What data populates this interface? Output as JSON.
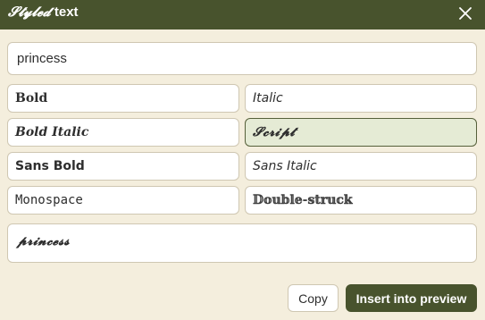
{
  "dialog": {
    "title_styled": "𝓢𝓽𝔂𝓵𝓮𝓭",
    "title_rest": " text",
    "close_icon": "close-icon"
  },
  "input": {
    "value": "princess",
    "placeholder": ""
  },
  "styles": [
    {
      "label": "Bold",
      "selected": false
    },
    {
      "label": "Italic",
      "selected": false
    },
    {
      "label": "Bold Italic",
      "selected": false
    },
    {
      "label": "𝓢𝓬𝓻𝓲𝓹𝓽",
      "selected": true
    },
    {
      "label": "Sans Bold",
      "selected": false
    },
    {
      "label": "Sans Italic",
      "selected": false
    },
    {
      "label": "Monospace",
      "selected": false
    },
    {
      "label": "𝔻𝕠𝕦𝕓𝕝𝕖-𝕤𝕥𝕣𝕦𝕔𝕜",
      "selected": false
    }
  ],
  "preview": {
    "text": "𝓹𝓻𝓲𝓷𝓬𝓮𝓼𝓼"
  },
  "actions": {
    "copy_label": "Copy",
    "insert_label": "Insert into preview"
  },
  "colors": {
    "titlebar": "#48532d",
    "background": "#f4eedd",
    "selected_fill": "#e5ebd5",
    "primary_button": "#48532d"
  }
}
